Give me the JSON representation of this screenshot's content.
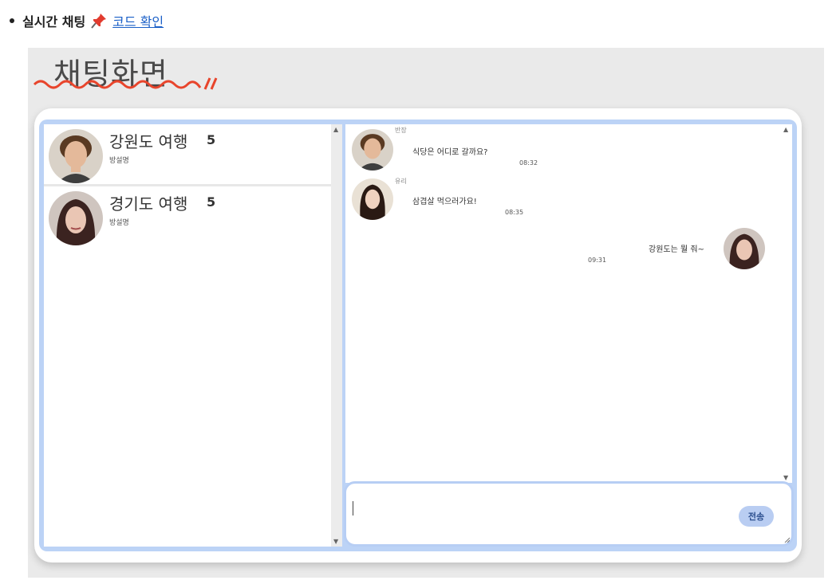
{
  "bullet": {
    "label": "실시간 채팅",
    "link": "코드 확인"
  },
  "screen": {
    "heading": "채팅화면"
  },
  "rooms": [
    {
      "title": "강원도 여행",
      "count": "5",
      "desc": "방설명"
    },
    {
      "title": "경기도 여행",
      "count": "5",
      "desc": "방설명"
    }
  ],
  "messages": [
    {
      "side": "left",
      "name": "반장",
      "text": "식당은 어디로 갈까요?",
      "time": "08:32"
    },
    {
      "side": "left",
      "name": "유리",
      "text": "삼겹살 먹으러가요!",
      "time": "08:35"
    },
    {
      "side": "right",
      "text": "강원도는 뭘 줘~",
      "time": "09:31"
    }
  ],
  "input": {
    "send_label": "전송"
  },
  "colors": {
    "accent": "#bcd3f6",
    "link": "#1a5fc7",
    "squiggle": "#e8452c"
  }
}
